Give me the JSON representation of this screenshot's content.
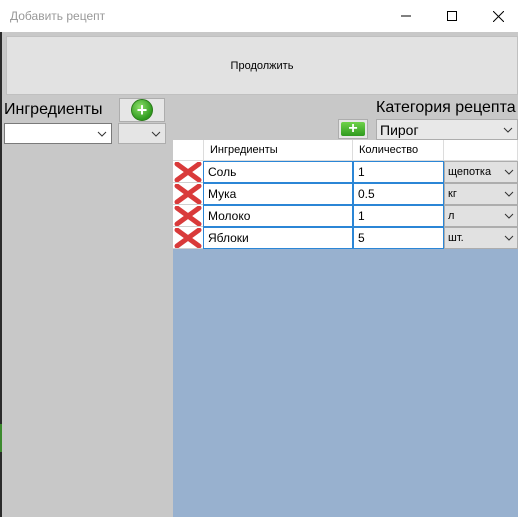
{
  "window": {
    "title": "Добавить рецепт"
  },
  "toolbar": {
    "continue_label": "Продолжить"
  },
  "ingredients_panel": {
    "label": "Ингредиенты",
    "selected_ingredient": "",
    "selected_unit": ""
  },
  "category": {
    "label": "Категория рецепта",
    "selected": "Пирог"
  },
  "grid": {
    "headers": [
      "Ингредиенты",
      "Количество"
    ],
    "rows": [
      {
        "name": "Соль",
        "amount": "1",
        "unit": "щепотка"
      },
      {
        "name": "Мука",
        "amount": "0.5",
        "unit": "кг"
      },
      {
        "name": "Молоко",
        "amount": "1",
        "unit": "л"
      },
      {
        "name": "Яблоки",
        "amount": "5",
        "unit": "шт."
      }
    ]
  },
  "icons": {
    "delete": "red-x-icon",
    "add": "green-plus-icon",
    "dropdown": "chevron-down-icon"
  },
  "colors": {
    "grid_background": "#98b1cf",
    "cell_focus_border": "#2b86d6",
    "delete_icon": "#d93a3a",
    "add_icon": "#2f9a1e"
  }
}
